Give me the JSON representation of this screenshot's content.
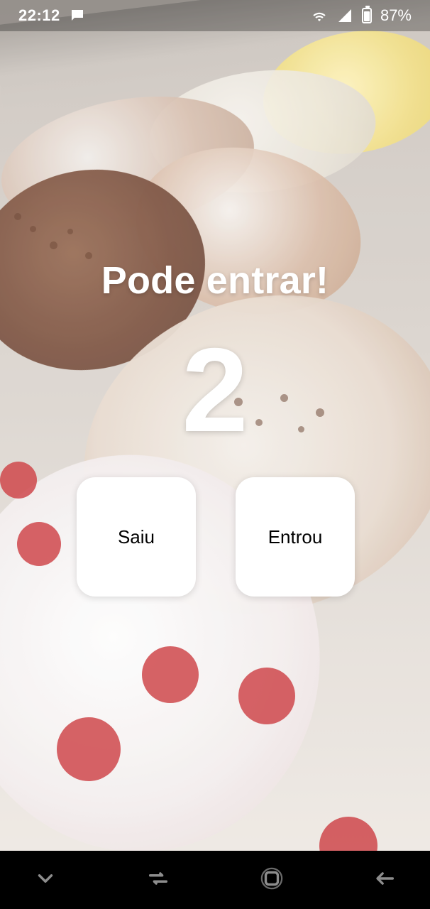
{
  "status_bar": {
    "time": "22:12",
    "battery_percent": "87%",
    "icons": [
      "chat-bubble-icon",
      "wifi-icon",
      "cellular-signal-icon",
      "battery-icon"
    ]
  },
  "main": {
    "title": "Pode entrar!",
    "count": "2",
    "buttons": {
      "left": "Saiu",
      "right": "Entrou"
    }
  },
  "navigation_bar": {
    "buttons": [
      "chevron-down-icon",
      "recent-apps-icon",
      "home-icon",
      "back-icon"
    ]
  },
  "colors": {
    "nav_background": "#000000",
    "button_background": "#ffffff",
    "text_primary": "#ffffff",
    "button_text": "#000000"
  }
}
